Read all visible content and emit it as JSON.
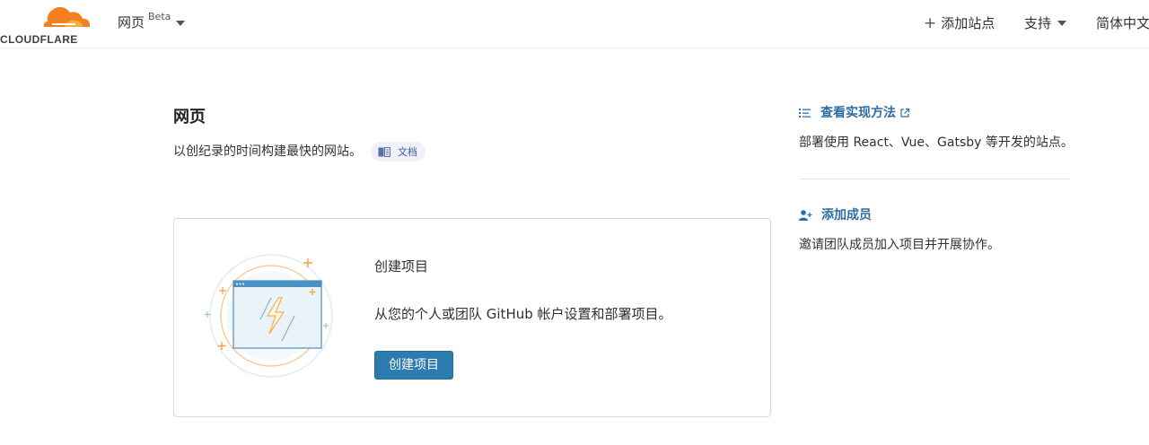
{
  "header": {
    "logo_text": "CLOUDFLARE",
    "product_name": "网页",
    "product_badge": "Beta",
    "add_site": "添加站点",
    "support": "支持",
    "language": "简体中文"
  },
  "main": {
    "title": "网页",
    "subtitle": "以创纪录的时间构建最快的网站。",
    "docs_label": "文档",
    "card": {
      "title": "创建项目",
      "description": "从您的个人或团队 GitHub 帐户设置和部署项目。",
      "button_label": "创建项目"
    }
  },
  "sidebar": {
    "how_to": {
      "title": "查看实现方法",
      "text": "部署使用 React、Vue、Gatsby 等开发的站点。"
    },
    "members": {
      "title": "添加成员",
      "text": "邀请团队成员加入项目并开展协作。"
    }
  },
  "colors": {
    "brand_orange": "#f38020",
    "link_blue": "#2c6ea3",
    "button_blue": "#2c7cb0"
  },
  "icons": [
    "cloudflare-logo",
    "caret-down-icon",
    "plus-icon",
    "book-icon",
    "list-icon",
    "external-link-icon",
    "user-add-icon"
  ]
}
